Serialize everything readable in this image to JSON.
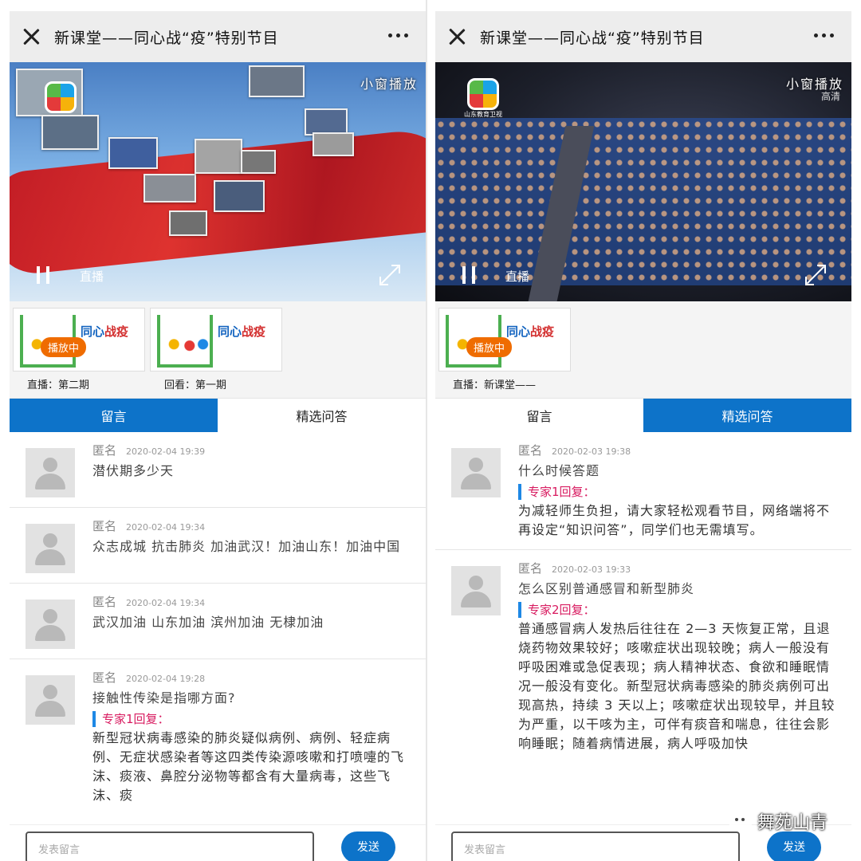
{
  "left": {
    "title": "新课堂——同心战“疫”特别节目",
    "video": {
      "badge": "小窗播放",
      "status": "直播",
      "hd": ""
    },
    "episodes": [
      {
        "thumb_title_a": "同心",
        "thumb_title_b": "战疫",
        "playing_badge": "播放中",
        "caption": "直播：第二期"
      },
      {
        "thumb_title_a": "同心",
        "thumb_title_b": "战疫",
        "playing_badge": "",
        "caption": "回看：第一期"
      }
    ],
    "tabs": [
      {
        "label": "留言",
        "active": true
      },
      {
        "label": "精选问答",
        "active": false
      }
    ],
    "comments": [
      {
        "author": "匿名",
        "time": "2020-02-04 19:39",
        "text": "潜伏期多少天"
      },
      {
        "author": "匿名",
        "time": "2020-02-04 19:34",
        "text": "众志成城 抗击肺炎 加油武汉！加油山东！加油中国"
      },
      {
        "author": "匿名",
        "time": "2020-02-04 19:34",
        "text": "武汉加油 山东加油 滨州加油 无棣加油"
      },
      {
        "author": "匿名",
        "time": "2020-02-04 19:28",
        "text": "接触性传染是指哪方面?",
        "expert": "专家1回复：",
        "answer": "新型冠状病毒感染的肺炎疑似病例、病例、轻症病例、无症状感染者等这四类传染源咳嗽和打喷嚏的飞沫、痰液、鼻腔分泌物等都含有大量病毒，这些飞沫、痰"
      }
    ],
    "input": {
      "placeholder": "发表留言",
      "send": "发送"
    }
  },
  "right": {
    "title": "新课堂——同心战“疫”特别节目",
    "video": {
      "badge": "小窗播放",
      "status": "直播",
      "hd": "高清",
      "logo_caption": "山东教育卫视"
    },
    "episodes": [
      {
        "thumb_title_a": "同心",
        "thumb_title_b": "战疫",
        "playing_badge": "播放中",
        "caption": "直播：新课堂——"
      }
    ],
    "tabs": [
      {
        "label": "留言",
        "active": false
      },
      {
        "label": "精选问答",
        "active": true
      }
    ],
    "comments": [
      {
        "author": "匿名",
        "time": "2020-02-03 19:38",
        "text": "什么时候答题",
        "expert": "专家1回复：",
        "answer": "为减轻师生负担，请大家轻松观看节目，网络端将不再设定“知识问答”，同学们也无需填写。"
      },
      {
        "author": "匿名",
        "time": "2020-02-03 19:33",
        "text": "怎么区别普通感冒和新型肺炎",
        "expert": "专家2回复：",
        "answer": "普通感冒病人发热后往往在 2—3 天恢复正常，且退烧药物效果较好；咳嗽症状出现较晚；病人一般没有呼吸困难或急促表现；病人精神状态、食欲和睡眠情况一般没有变化。新型冠状病毒感染的肺炎病例可出现高热，持续 3 天以上；咳嗽症状出现较早，并且较为严重，以干咳为主，可伴有痰音和喘息，往往会影响睡眠；随着病情进展，病人呼吸加快"
      }
    ],
    "input": {
      "placeholder": "发表留言",
      "send": "发送"
    }
  },
  "watermark": "舞苑山青"
}
